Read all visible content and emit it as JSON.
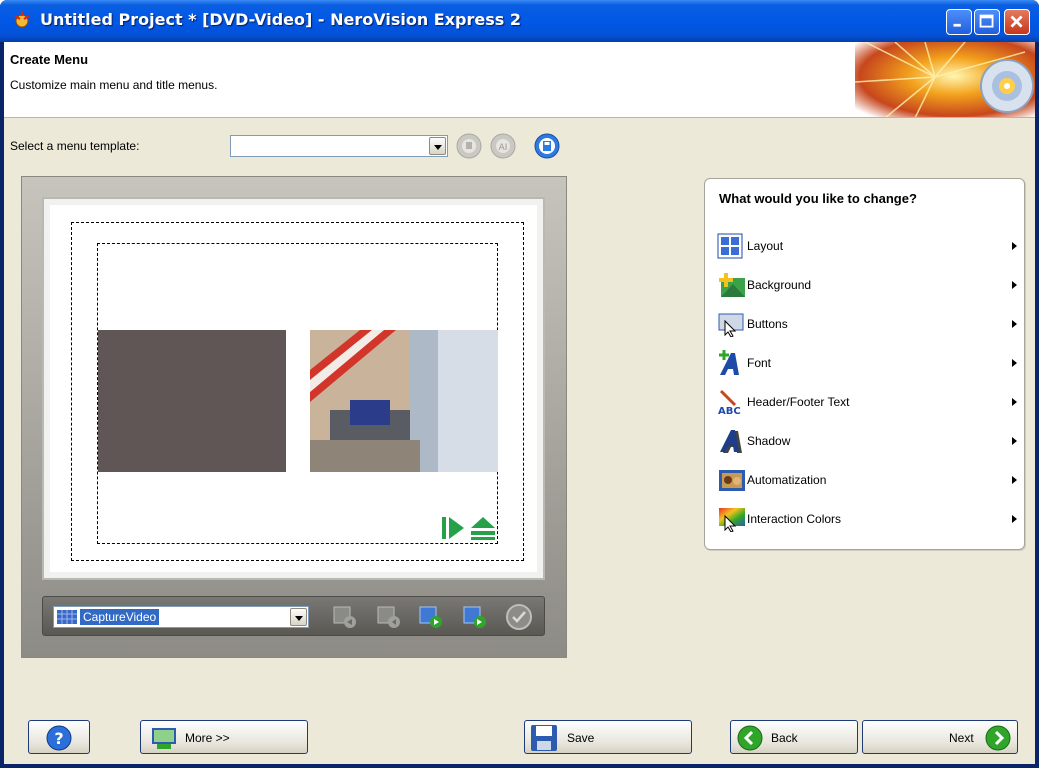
{
  "window": {
    "title": "Untitled Project * [DVD-Video] - NeroVision Express 2",
    "controls": [
      "minimize-icon",
      "maximize-icon",
      "close-icon"
    ]
  },
  "header": {
    "title": "Create Menu",
    "subtitle": "Customize main menu and title menus."
  },
  "template": {
    "label": "Select a menu template:",
    "value": ""
  },
  "preview": {
    "selector_value": "CaptureVideo",
    "toolbar_icons": [
      "first-title-icon",
      "previous-title-icon",
      "next-title-icon",
      "last-title-icon",
      "check-icon"
    ],
    "nav_icons": [
      "play-icon",
      "eject-icon"
    ]
  },
  "change_panel": {
    "title": "What would you like to change?",
    "items": [
      {
        "label": "Layout",
        "icon": "layout-icon"
      },
      {
        "label": "Background",
        "icon": "background-icon"
      },
      {
        "label": "Buttons",
        "icon": "buttons-icon"
      },
      {
        "label": "Font",
        "icon": "font-icon"
      },
      {
        "label": "Header/Footer Text",
        "icon": "header-footer-text-icon"
      },
      {
        "label": "Shadow",
        "icon": "shadow-icon"
      },
      {
        "label": "Automatization",
        "icon": "automatization-icon"
      },
      {
        "label": "Interaction Colors",
        "icon": "interaction-colors-icon"
      }
    ]
  },
  "footer": {
    "help_icon": "help-icon",
    "more_label": "More >>",
    "save_label": "Save",
    "back_label": "Back",
    "next_label": "Next"
  },
  "colors": {
    "titlebar": "#0058e6",
    "client_bg": "#ece9d8",
    "selection": "#316ac5",
    "green_accent": "#2fa62a"
  }
}
